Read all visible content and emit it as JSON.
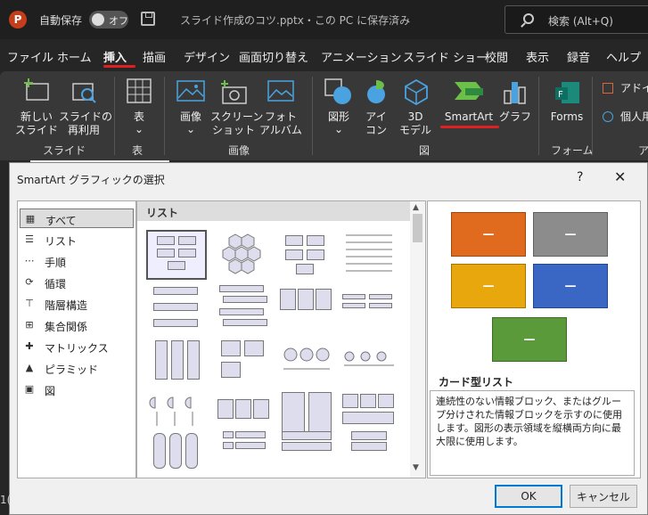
{
  "titlebar": {
    "logo_letter": "P",
    "autosave_label": "自動保存",
    "autosave_toggle": "オフ",
    "document_title": "スライド作成のコツ.pptx・この PC に保存済み",
    "search_placeholder": "検索 (Alt+Q)"
  },
  "menu": {
    "tabs": [
      "ファイル",
      "ホーム",
      "挿入",
      "描画",
      "デザイン",
      "画面切り替え",
      "アニメーション",
      "スライド ショー",
      "校閲",
      "表示",
      "録音",
      "ヘルプ"
    ],
    "active_tab": "挿入"
  },
  "ribbon": {
    "buttons": {
      "new_slide": "新しい\nスライド",
      "reuse_slide": "スライドの\n再利用",
      "table": "表",
      "image": "画像",
      "screenshot": "スクリーン\nショット",
      "photo_album": "フォト\nアルバム",
      "shapes": "図形",
      "icons": "アイ\nコン",
      "model3d": "3D\nモデル",
      "smartart": "SmartArt",
      "chart": "グラフ",
      "forms": "Forms",
      "addins": "アドイン",
      "personal": "個人用"
    },
    "groups": {
      "slides": "スライド",
      "tables": "表",
      "images": "画像",
      "illustrations": "図",
      "forms": "フォーム",
      "addins": "ア"
    },
    "dropdown_glyph": "⌄"
  },
  "dialog": {
    "title": "SmartArt グラフィックの選択",
    "help": "?",
    "close": "✕",
    "categories": [
      "すべて",
      "リスト",
      "手順",
      "循環",
      "階層構造",
      "集合関係",
      "マトリックス",
      "ピラミッド",
      "図"
    ],
    "selected_category": "すべて",
    "section_header": "リスト",
    "preview": {
      "box_glyph": "—",
      "colors": [
        "#e06a1d",
        "#8c8c8c",
        "#e8a80d",
        "#3a67c4",
        "#5a9a3a"
      ]
    },
    "description_title": "カード型リスト",
    "description_text": "連続性のない情報ブロック、またはグループ分けされた情報ブロックを示すのに使用します。図形の表示領域を縦横両方向に最大限に使用します。",
    "ok_label": "OK",
    "cancel_label": "キャンセル"
  },
  "edge_fragment": "1("
}
